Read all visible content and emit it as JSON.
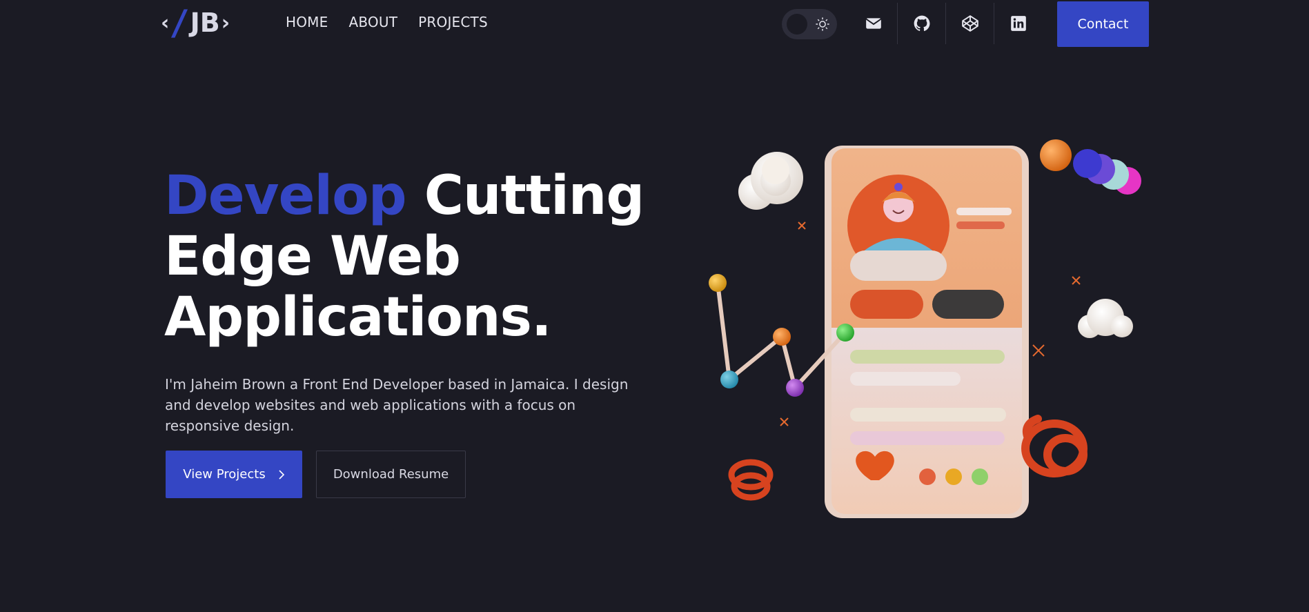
{
  "nav": {
    "logo": {
      "open": "‹",
      "slash": "/",
      "initials": "JB",
      "close": "›"
    },
    "links": [
      "HOME",
      "ABOUT",
      "PROJECTS"
    ],
    "theme_toggle_icon": "sun-icon",
    "socials": [
      "mail-icon",
      "github-icon",
      "codepen-icon",
      "linkedin-icon"
    ],
    "contact_label": "Contact"
  },
  "hero": {
    "headline_accent": "Develop",
    "headline_rest_1": " Cutting",
    "headline_rest_2": "Edge Web",
    "headline_rest_3": "Applications.",
    "intro": "I'm Jaheim Brown a Front End Developer based in Jamaica. I design and develop websites and web applications with a focus on responsive design.",
    "primary_button": "View Projects",
    "primary_button_icon": "chevron-right-icon",
    "secondary_button": "Download Resume"
  },
  "colors": {
    "background": "#1b1b24",
    "accent": "#3446c4",
    "text": "#ffffff"
  }
}
